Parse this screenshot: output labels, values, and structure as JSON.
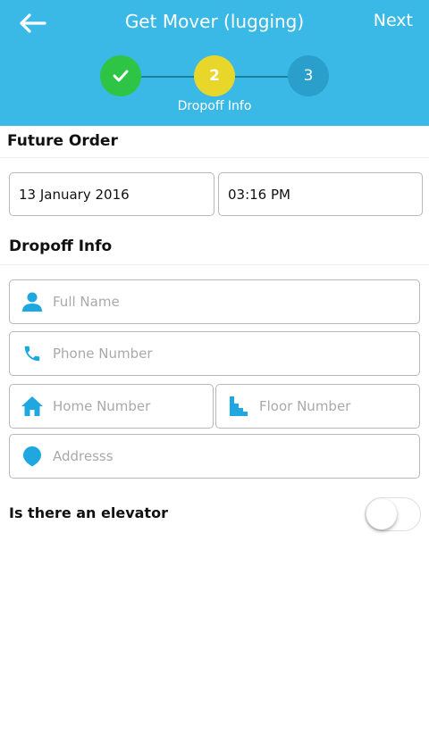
{
  "header": {
    "title": "Get Mover (lugging)",
    "next_label": "Next",
    "back_icon": "arrow-left-icon",
    "background_color": "#3bb9e6"
  },
  "stepper": {
    "steps": [
      {
        "label": "",
        "state": "completed",
        "icon": "checkmark-icon",
        "color": "#2ec546"
      },
      {
        "label": "2",
        "state": "current",
        "color": "#e8d72a"
      },
      {
        "label": "3",
        "state": "upcoming",
        "color": "#2a9fcb"
      }
    ],
    "current_caption": "Dropoff Info"
  },
  "future_order": {
    "title": "Future Order",
    "date": "13 January 2016",
    "time": "03:16 PM"
  },
  "dropoff": {
    "title": "Dropoff Info",
    "full_name_placeholder": "Full Name",
    "phone_placeholder": "Phone Number",
    "home_placeholder": "Home Number",
    "floor_placeholder": "Floor Number",
    "address_placeholder": "Addresss",
    "icon_color": "#1fa8e0"
  },
  "elevator": {
    "label": "Is there an elevator",
    "enabled": false
  }
}
